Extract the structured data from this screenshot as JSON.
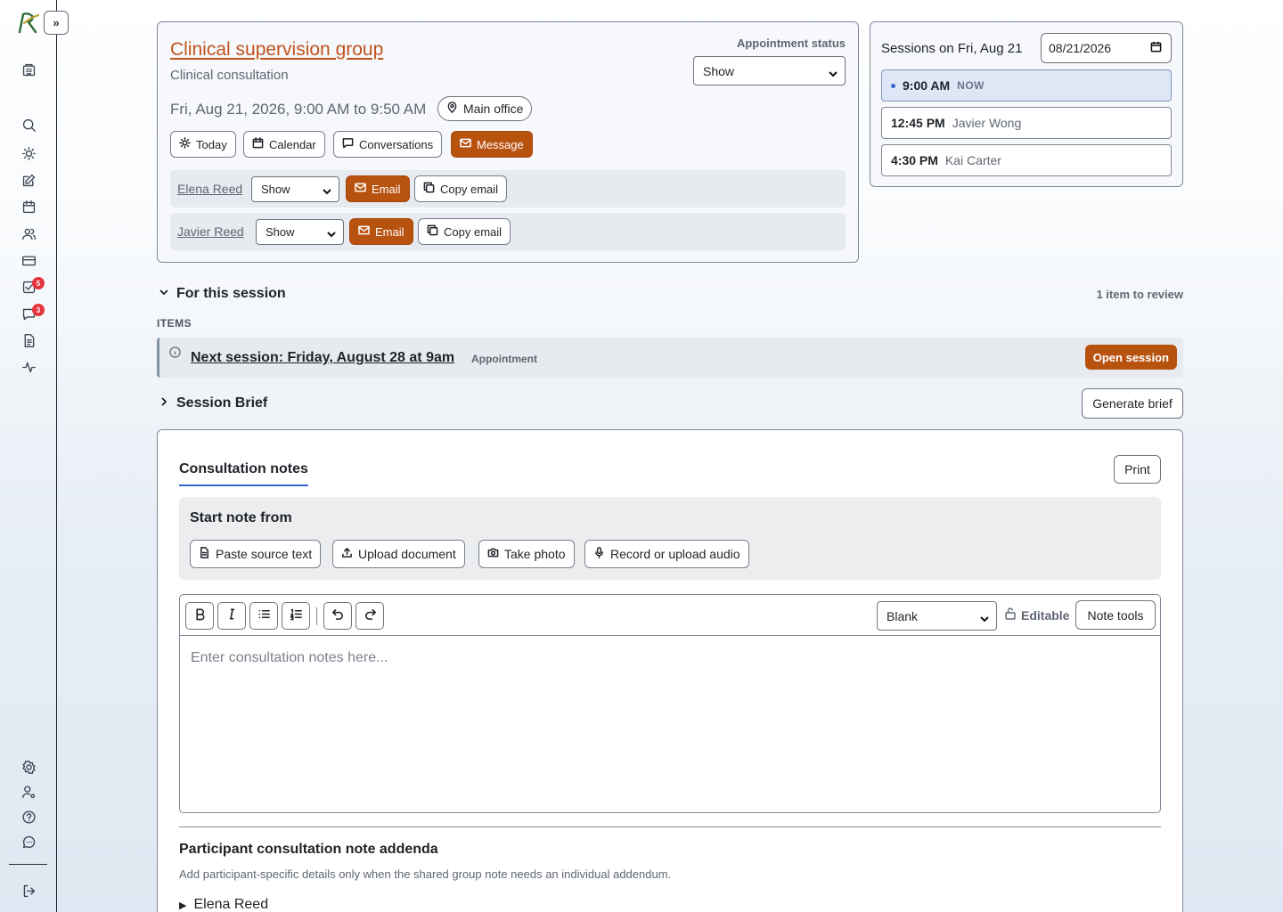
{
  "appointment": {
    "title": "Clinical supervision group",
    "type": "Clinical consultation",
    "datetime": "Fri, Aug 21, 2026, 9:00 AM to 9:50 AM",
    "location": "Main office",
    "status_label": "Appointment status",
    "status_value": "Show",
    "actions": {
      "today": "Today",
      "calendar": "Calendar",
      "conversations": "Conversations",
      "message": "Message"
    },
    "participants": [
      {
        "name": "Elena Reed",
        "status": "Show",
        "email_label": "Email",
        "copy_label": "Copy email"
      },
      {
        "name": "Javier Reed",
        "status": "Show",
        "email_label": "Email",
        "copy_label": "Copy email"
      }
    ]
  },
  "sessions": {
    "title": "Sessions on Fri, Aug 21",
    "date_value": "08/21/2026",
    "slots": [
      {
        "time": "9:00 AM",
        "who": "",
        "tag": "NOW"
      },
      {
        "time": "12:45 PM",
        "who": "Javier Wong"
      },
      {
        "time": "4:30 PM",
        "who": "Kai Carter"
      }
    ]
  },
  "for_session": {
    "heading": "For this session",
    "review_count": "1 item to review",
    "items_label": "ITEMS",
    "item_title": "Next session: Friday, August 28 at 9am",
    "item_type": "Appointment",
    "item_action": "Open session"
  },
  "brief": {
    "heading": "Session Brief",
    "generate": "Generate brief"
  },
  "notes": {
    "tab": "Consultation notes",
    "print": "Print",
    "start_from": "Start note from",
    "sources": {
      "paste": "Paste source text",
      "upload": "Upload document",
      "photo": "Take photo",
      "audio": "Record or upload audio"
    },
    "template": "Blank",
    "editable": "Editable",
    "note_tools": "Note tools",
    "placeholder": "Enter consultation notes here..."
  },
  "addenda": {
    "heading": "Participant consultation note addenda",
    "description": "Add participant-specific details only when the shared group note needs an individual addendum.",
    "first_participant": "Elena Reed"
  },
  "sidebar": {
    "badges": {
      "tasks": "5",
      "messages": "3"
    }
  },
  "colors": {
    "accent": "#b8520f",
    "link_accent": "#c0531b",
    "now_bg": "#dde7f6",
    "now_dot": "#3a66c9",
    "badge": "#e4343e"
  }
}
